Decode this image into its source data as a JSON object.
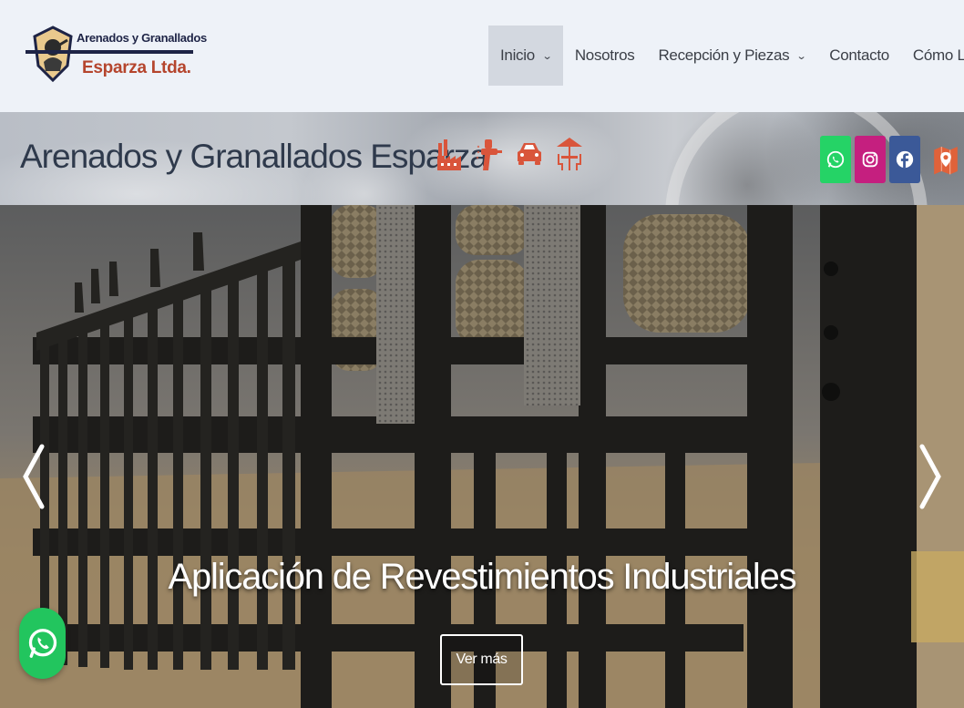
{
  "header": {
    "logo": {
      "line1": "Arenados y Granallados",
      "line2": "Esparza Ltda."
    },
    "nav": [
      {
        "label": "Inicio",
        "dropdown": true,
        "active": true
      },
      {
        "label": "Nosotros",
        "dropdown": false,
        "active": false
      },
      {
        "label": "Recepción y Piezas",
        "dropdown": true,
        "active": false
      },
      {
        "label": "Contacto",
        "dropdown": false,
        "active": false
      },
      {
        "label": "Cómo Llegar",
        "dropdown": false,
        "active": false
      }
    ]
  },
  "band": {
    "title": "Arenados y Granallados Esparza",
    "icons": [
      "factory-icon",
      "spray-gun-icon",
      "car-icon",
      "cafe-table-icon"
    ],
    "social": [
      {
        "name": "whatsapp-icon",
        "color": "#25d366"
      },
      {
        "name": "instagram-icon",
        "color": "#c51f7f"
      },
      {
        "name": "facebook-icon",
        "color": "#3b5998"
      },
      {
        "name": "map-icon",
        "color": "#e0623a"
      }
    ]
  },
  "hero": {
    "title": "Aplicación de Revestimientos Industriales",
    "button": "Ver más",
    "prev_icon": "chevron-left-icon",
    "next_icon": "chevron-right-icon"
  },
  "floating": {
    "icon": "whatsapp-icon",
    "color": "#22c55e"
  },
  "colors": {
    "accent": "#b5452d",
    "navy": "#1e2446",
    "header_bg": "#eef2f8"
  }
}
